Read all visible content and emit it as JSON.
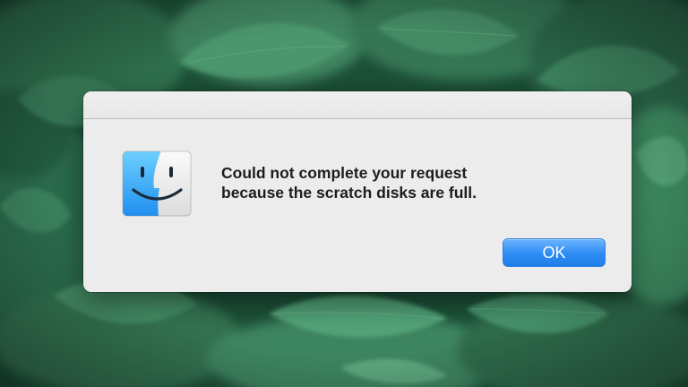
{
  "dialog": {
    "message_line1": "Could not complete your request",
    "message_line2": "because the scratch disks are full.",
    "ok_label": "OK",
    "icon": "finder-icon"
  },
  "colors": {
    "dialog_background": "#ececec",
    "button_blue": "#2d8cf4",
    "wallpaper_green": "#1f5a3e"
  }
}
